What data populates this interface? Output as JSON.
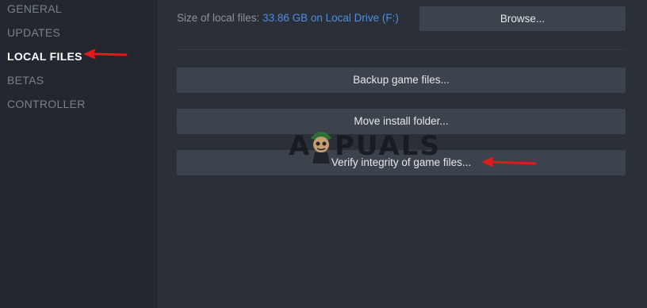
{
  "sidebar": {
    "items": [
      {
        "label": "GENERAL",
        "active": false
      },
      {
        "label": "UPDATES",
        "active": false
      },
      {
        "label": "LOCAL FILES",
        "active": true
      },
      {
        "label": "BETAS",
        "active": false
      },
      {
        "label": "CONTROLLER",
        "active": false
      }
    ]
  },
  "local_files": {
    "size_label": "Size of local files:",
    "size_value": "33.86 GB on Local Drive (F:)",
    "browse_label": "Browse...",
    "backup_label": "Backup game files...",
    "move_label": "Move install folder...",
    "verify_label": "Verify integrity of game files..."
  },
  "watermark": {
    "left": "A",
    "right": "PUALS"
  },
  "colors": {
    "sidebar_bg": "#23272f",
    "main_bg": "#2a2f38",
    "button_bg": "#3d434d",
    "link_blue": "#4f8ee0",
    "annotation_arrow": "#e01b1b"
  }
}
